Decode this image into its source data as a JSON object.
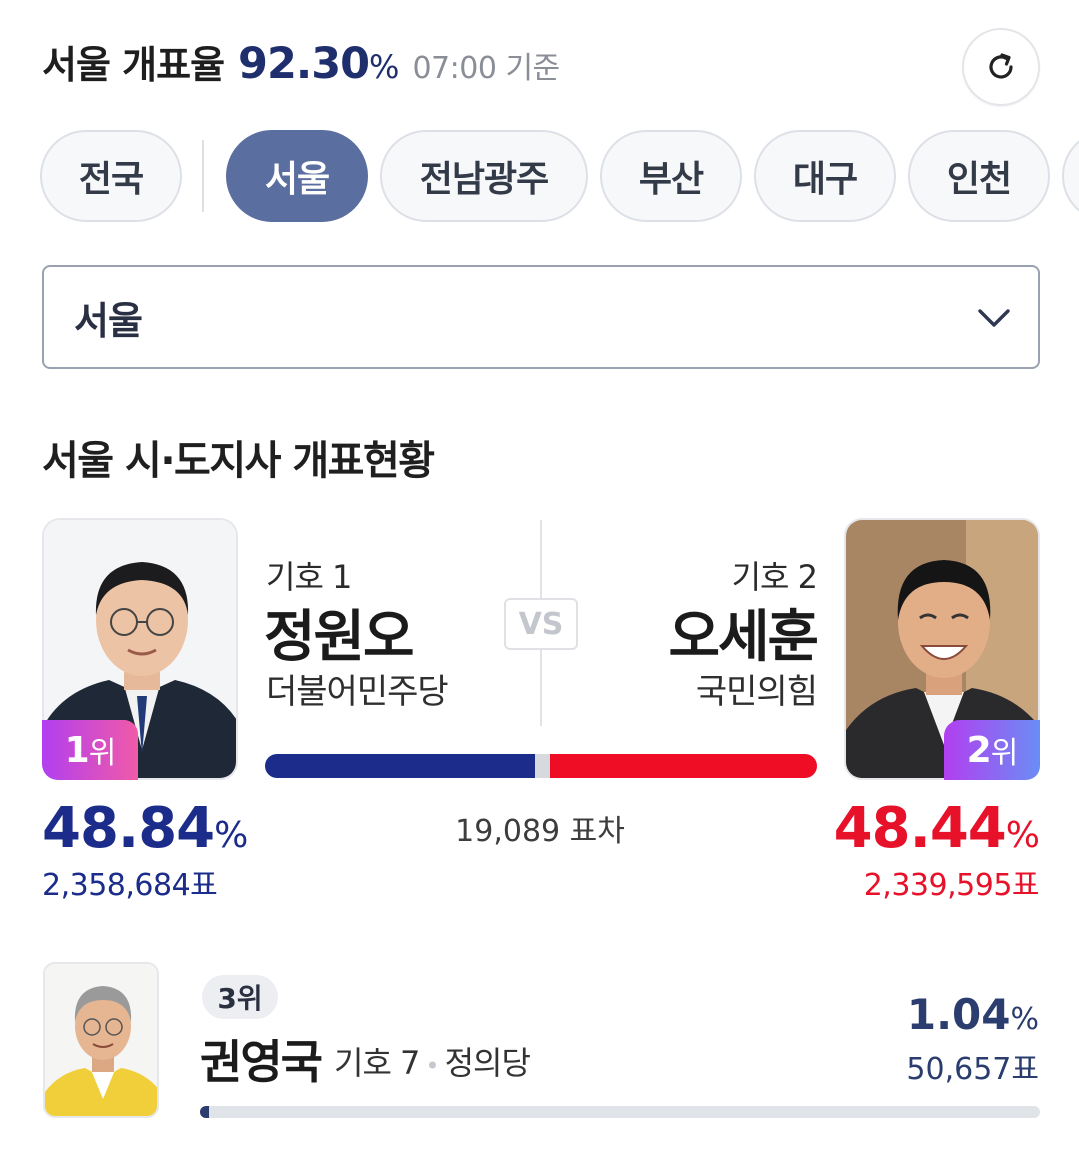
{
  "header": {
    "region": "서울 개표율",
    "rate": "92.30",
    "rate_unit": "%",
    "time": "07:00 기준"
  },
  "tabs": [
    {
      "label": "전국",
      "active": false
    },
    {
      "label": "서울",
      "active": true
    },
    {
      "label": "전남광주",
      "active": false
    },
    {
      "label": "부산",
      "active": false
    },
    {
      "label": "대구",
      "active": false
    },
    {
      "label": "인천",
      "active": false
    }
  ],
  "select": {
    "value": "서울"
  },
  "section_title": "서울 시·도지사 개표현황",
  "vs_label": "VS",
  "candidates": [
    {
      "rank": "1",
      "rank_unit": "위",
      "number_label": "기호 1",
      "name": "정원오",
      "party": "더불어민주당",
      "percent": "48.84",
      "percent_unit": "%",
      "votes": "2,358,684표",
      "color": "#1b2c8a",
      "share": 48.84
    },
    {
      "rank": "2",
      "rank_unit": "위",
      "number_label": "기호 2",
      "name": "오세훈",
      "party": "국민의힘",
      "percent": "48.44",
      "percent_unit": "%",
      "votes": "2,339,595표",
      "color": "#ef0d26",
      "share": 48.44
    }
  ],
  "vote_gap": "19,089 표차",
  "third": {
    "rank": "3위",
    "name": "권영국",
    "number_label": "기호 7",
    "party": "정의당",
    "percent": "1.04",
    "percent_unit": "%",
    "votes": "50,657표",
    "share": 1.04,
    "color": "#2a3d6e"
  }
}
